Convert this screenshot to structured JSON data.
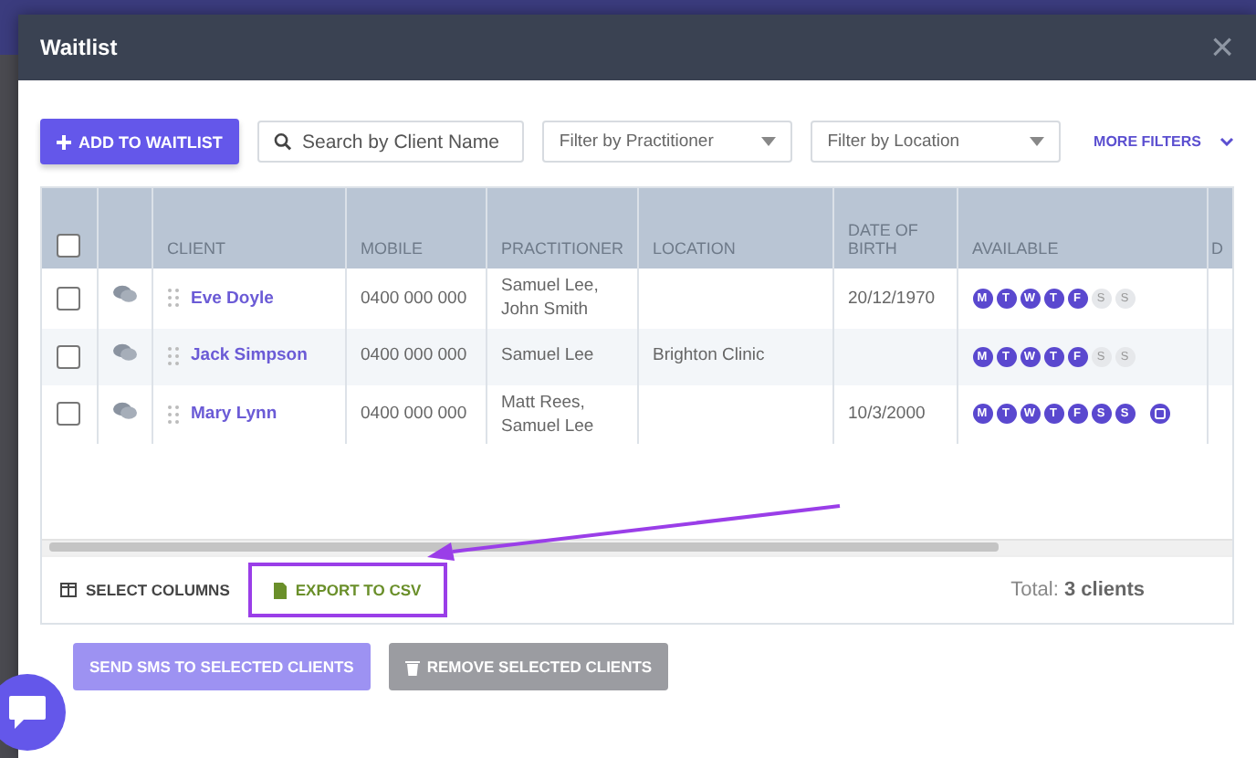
{
  "window": {
    "title": "Waitlist",
    "close": "×"
  },
  "toolbar": {
    "add_button": "ADD TO WAITLIST",
    "search": {
      "placeholder": "Search by Client Name"
    },
    "filters": [
      {
        "placeholder": "Filter by Practitioner"
      },
      {
        "placeholder": "Filter by Location"
      }
    ],
    "more_filters": "MORE FILTERS"
  },
  "table": {
    "select_all": {
      "checked": false
    },
    "columns": [
      "CLIENT",
      "MOBILE",
      "PRACTITIONER",
      "LOCATION",
      "DATE OF BIRTH",
      "AVAILABLE",
      "D"
    ],
    "rows": [
      {
        "checked": false,
        "client": "Eve Doyle",
        "mobile": "0400 000 000",
        "practitioner": "Samuel Lee, John Smith",
        "location": "",
        "dob": "20/12/1970",
        "note": false,
        "days": [
          {
            "label": "M",
            "selected": true
          },
          {
            "label": "T",
            "selected": true
          },
          {
            "label": "W",
            "selected": true
          },
          {
            "label": "T",
            "selected": true
          },
          {
            "label": "F",
            "selected": true
          },
          {
            "label": "S",
            "selected": false
          },
          {
            "label": "S",
            "selected": false
          }
        ]
      },
      {
        "checked": false,
        "client": "Jack Simpson",
        "mobile": "0400 000 000",
        "practitioner": "Samuel Lee",
        "location": "Brighton Clinic",
        "dob": "",
        "note": false,
        "days": [
          {
            "label": "M",
            "selected": true
          },
          {
            "label": "T",
            "selected": true
          },
          {
            "label": "W",
            "selected": true
          },
          {
            "label": "T",
            "selected": true
          },
          {
            "label": "F",
            "selected": true
          },
          {
            "label": "S",
            "selected": false
          },
          {
            "label": "S",
            "selected": false
          }
        ]
      },
      {
        "checked": false,
        "client": "Mary Lynn",
        "mobile": "0400 000 000",
        "practitioner": "Matt Rees, Samuel Lee",
        "location": "",
        "dob": "10/3/2000",
        "note": true,
        "days": [
          {
            "label": "M",
            "selected": true
          },
          {
            "label": "T",
            "selected": true
          },
          {
            "label": "W",
            "selected": true
          },
          {
            "label": "T",
            "selected": true
          },
          {
            "label": "F",
            "selected": true
          },
          {
            "label": "S",
            "selected": true
          },
          {
            "label": "S",
            "selected": true
          }
        ]
      }
    ]
  },
  "footer": {
    "select_columns": "SELECT COLUMNS",
    "export": "EXPORT TO CSV",
    "total_label": "Total:",
    "total_value": "3 clients"
  },
  "actions": [
    {
      "label": "SEND SMS TO SELECTED CLIENTS",
      "kind": "sms"
    },
    {
      "label": "REMOVE SELECTED CLIENTS",
      "kind": "remove"
    }
  ]
}
